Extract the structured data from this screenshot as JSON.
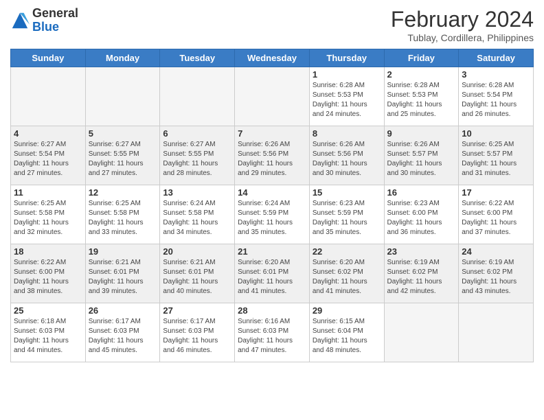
{
  "header": {
    "logo_general": "General",
    "logo_blue": "Blue",
    "month_title": "February 2024",
    "location": "Tublay, Cordillera, Philippines"
  },
  "days_of_week": [
    "Sunday",
    "Monday",
    "Tuesday",
    "Wednesday",
    "Thursday",
    "Friday",
    "Saturday"
  ],
  "weeks": [
    [
      {
        "day": "",
        "info": ""
      },
      {
        "day": "",
        "info": ""
      },
      {
        "day": "",
        "info": ""
      },
      {
        "day": "",
        "info": ""
      },
      {
        "day": "1",
        "info": "Sunrise: 6:28 AM\nSunset: 5:53 PM\nDaylight: 11 hours\nand 24 minutes."
      },
      {
        "day": "2",
        "info": "Sunrise: 6:28 AM\nSunset: 5:53 PM\nDaylight: 11 hours\nand 25 minutes."
      },
      {
        "day": "3",
        "info": "Sunrise: 6:28 AM\nSunset: 5:54 PM\nDaylight: 11 hours\nand 26 minutes."
      }
    ],
    [
      {
        "day": "4",
        "info": "Sunrise: 6:27 AM\nSunset: 5:54 PM\nDaylight: 11 hours\nand 27 minutes."
      },
      {
        "day": "5",
        "info": "Sunrise: 6:27 AM\nSunset: 5:55 PM\nDaylight: 11 hours\nand 27 minutes."
      },
      {
        "day": "6",
        "info": "Sunrise: 6:27 AM\nSunset: 5:55 PM\nDaylight: 11 hours\nand 28 minutes."
      },
      {
        "day": "7",
        "info": "Sunrise: 6:26 AM\nSunset: 5:56 PM\nDaylight: 11 hours\nand 29 minutes."
      },
      {
        "day": "8",
        "info": "Sunrise: 6:26 AM\nSunset: 5:56 PM\nDaylight: 11 hours\nand 30 minutes."
      },
      {
        "day": "9",
        "info": "Sunrise: 6:26 AM\nSunset: 5:57 PM\nDaylight: 11 hours\nand 30 minutes."
      },
      {
        "day": "10",
        "info": "Sunrise: 6:25 AM\nSunset: 5:57 PM\nDaylight: 11 hours\nand 31 minutes."
      }
    ],
    [
      {
        "day": "11",
        "info": "Sunrise: 6:25 AM\nSunset: 5:58 PM\nDaylight: 11 hours\nand 32 minutes."
      },
      {
        "day": "12",
        "info": "Sunrise: 6:25 AM\nSunset: 5:58 PM\nDaylight: 11 hours\nand 33 minutes."
      },
      {
        "day": "13",
        "info": "Sunrise: 6:24 AM\nSunset: 5:58 PM\nDaylight: 11 hours\nand 34 minutes."
      },
      {
        "day": "14",
        "info": "Sunrise: 6:24 AM\nSunset: 5:59 PM\nDaylight: 11 hours\nand 35 minutes."
      },
      {
        "day": "15",
        "info": "Sunrise: 6:23 AM\nSunset: 5:59 PM\nDaylight: 11 hours\nand 35 minutes."
      },
      {
        "day": "16",
        "info": "Sunrise: 6:23 AM\nSunset: 6:00 PM\nDaylight: 11 hours\nand 36 minutes."
      },
      {
        "day": "17",
        "info": "Sunrise: 6:22 AM\nSunset: 6:00 PM\nDaylight: 11 hours\nand 37 minutes."
      }
    ],
    [
      {
        "day": "18",
        "info": "Sunrise: 6:22 AM\nSunset: 6:00 PM\nDaylight: 11 hours\nand 38 minutes."
      },
      {
        "day": "19",
        "info": "Sunrise: 6:21 AM\nSunset: 6:01 PM\nDaylight: 11 hours\nand 39 minutes."
      },
      {
        "day": "20",
        "info": "Sunrise: 6:21 AM\nSunset: 6:01 PM\nDaylight: 11 hours\nand 40 minutes."
      },
      {
        "day": "21",
        "info": "Sunrise: 6:20 AM\nSunset: 6:01 PM\nDaylight: 11 hours\nand 41 minutes."
      },
      {
        "day": "22",
        "info": "Sunrise: 6:20 AM\nSunset: 6:02 PM\nDaylight: 11 hours\nand 41 minutes."
      },
      {
        "day": "23",
        "info": "Sunrise: 6:19 AM\nSunset: 6:02 PM\nDaylight: 11 hours\nand 42 minutes."
      },
      {
        "day": "24",
        "info": "Sunrise: 6:19 AM\nSunset: 6:02 PM\nDaylight: 11 hours\nand 43 minutes."
      }
    ],
    [
      {
        "day": "25",
        "info": "Sunrise: 6:18 AM\nSunset: 6:03 PM\nDaylight: 11 hours\nand 44 minutes."
      },
      {
        "day": "26",
        "info": "Sunrise: 6:17 AM\nSunset: 6:03 PM\nDaylight: 11 hours\nand 45 minutes."
      },
      {
        "day": "27",
        "info": "Sunrise: 6:17 AM\nSunset: 6:03 PM\nDaylight: 11 hours\nand 46 minutes."
      },
      {
        "day": "28",
        "info": "Sunrise: 6:16 AM\nSunset: 6:03 PM\nDaylight: 11 hours\nand 47 minutes."
      },
      {
        "day": "29",
        "info": "Sunrise: 6:15 AM\nSunset: 6:04 PM\nDaylight: 11 hours\nand 48 minutes."
      },
      {
        "day": "",
        "info": ""
      },
      {
        "day": "",
        "info": ""
      }
    ]
  ]
}
